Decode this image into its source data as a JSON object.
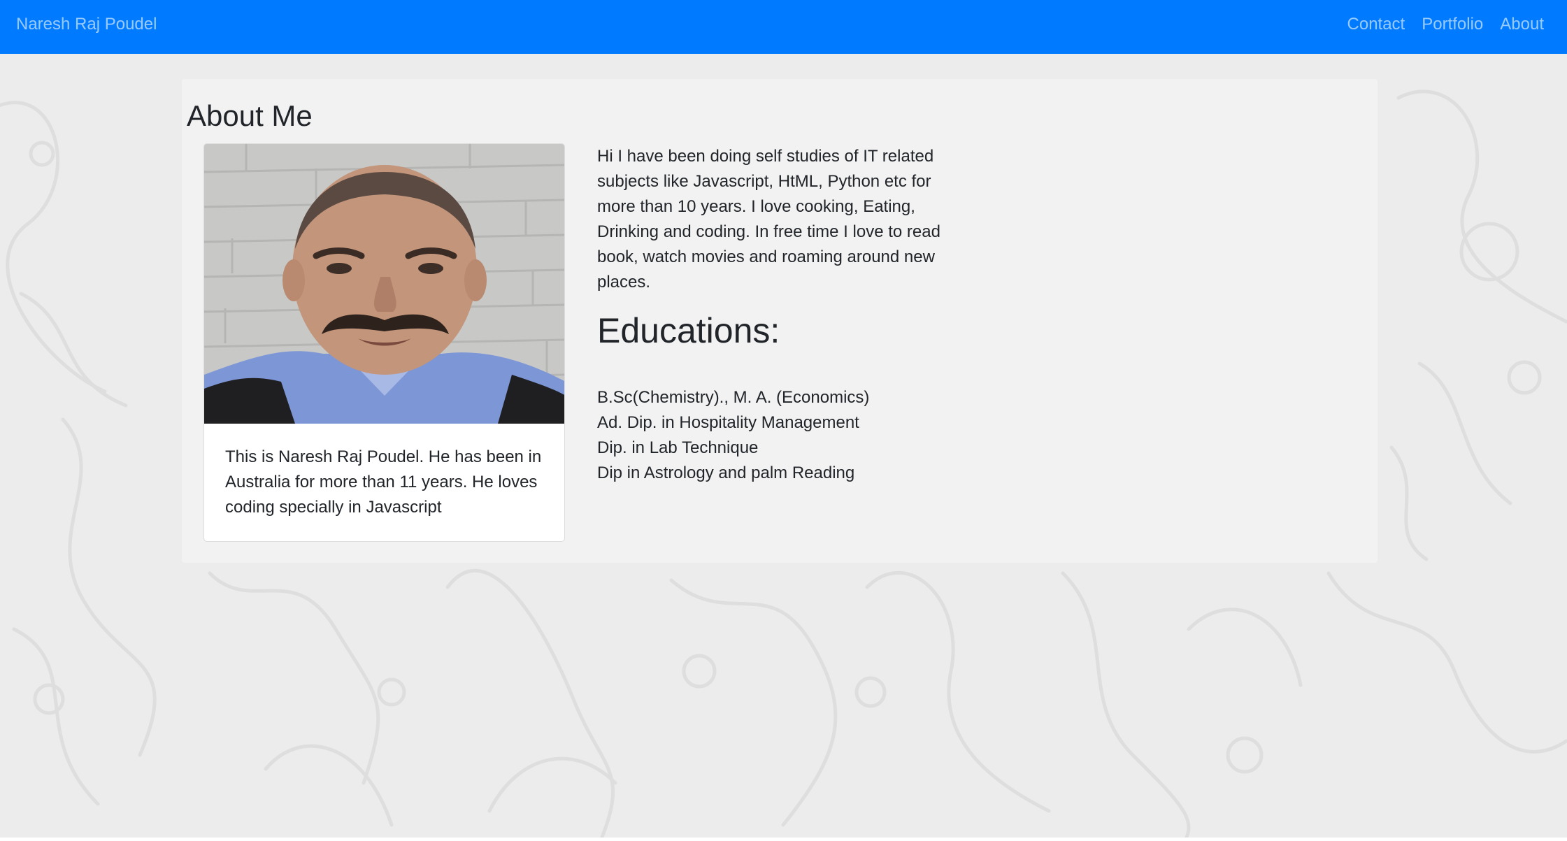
{
  "navbar": {
    "brand": "Naresh Raj Poudel",
    "links": [
      "Contact",
      "Portfolio",
      "About"
    ],
    "background": "#007bff"
  },
  "main": {
    "title": "About Me",
    "card": {
      "photo_alt": "Portrait photo of Naresh Raj Poudel",
      "caption": "This is Naresh Raj Poudel. He has been in Australia for more than 11 years. He loves coding specially in Javascript"
    },
    "bio": "Hi I have been doing self studies of IT related subjects like Javascript, HtML, Python etc for more than 10 years. I love cooking, Eating, Drinking and coding. In free time I love to read book, watch movies and roaming around new places.",
    "education": {
      "heading": "Educations:",
      "items": [
        "B.Sc(Chemistry)., M. A. (Economics)",
        "Ad. Dip. in Hospitality Management",
        "Dip. in Lab Technique",
        "Dip in Astrology and palm Reading"
      ]
    }
  },
  "colors": {
    "page_background": "#ececec",
    "panel_background": "#f2f2f2",
    "text": "#212529"
  }
}
